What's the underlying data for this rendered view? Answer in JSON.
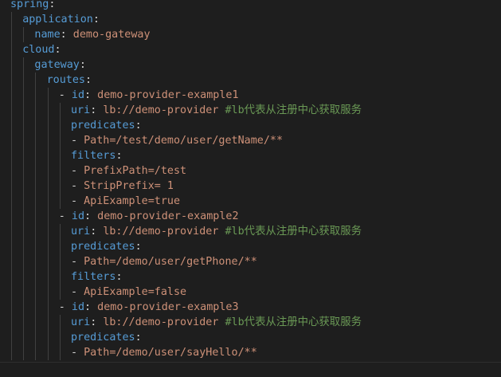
{
  "lines": [
    {
      "indent": 0,
      "dash": false,
      "key": "spring",
      "value": "",
      "comment": ""
    },
    {
      "indent": 1,
      "dash": false,
      "key": "application",
      "value": "",
      "comment": ""
    },
    {
      "indent": 2,
      "dash": false,
      "key": "name",
      "value": "demo-gateway",
      "comment": ""
    },
    {
      "indent": 1,
      "dash": false,
      "key": "cloud",
      "value": "",
      "comment": ""
    },
    {
      "indent": 2,
      "dash": false,
      "key": "gateway",
      "value": "",
      "comment": ""
    },
    {
      "indent": 3,
      "dash": false,
      "key": "routes",
      "value": "",
      "comment": ""
    },
    {
      "indent": 4,
      "dash": true,
      "key": "id",
      "value": "demo-provider-example1",
      "comment": ""
    },
    {
      "indent": 5,
      "dash": false,
      "key": "uri",
      "value": "lb://demo-provider",
      "comment": "#lb代表从注册中心获取服务"
    },
    {
      "indent": 5,
      "dash": false,
      "key": "predicates",
      "value": "",
      "comment": ""
    },
    {
      "indent": 5,
      "dash": true,
      "key": "",
      "value": "Path=/test/demo/user/getName/**",
      "comment": ""
    },
    {
      "indent": 5,
      "dash": false,
      "key": "filters",
      "value": "",
      "comment": ""
    },
    {
      "indent": 5,
      "dash": true,
      "key": "",
      "value": "PrefixPath=/test",
      "comment": ""
    },
    {
      "indent": 5,
      "dash": true,
      "key": "",
      "value": "StripPrefix= 1",
      "comment": ""
    },
    {
      "indent": 5,
      "dash": true,
      "key": "",
      "value": "ApiExample=true",
      "comment": ""
    },
    {
      "indent": 4,
      "dash": true,
      "key": "id",
      "value": "demo-provider-example2",
      "comment": ""
    },
    {
      "indent": 5,
      "dash": false,
      "key": "uri",
      "value": "lb://demo-provider",
      "comment": "#lb代表从注册中心获取服务"
    },
    {
      "indent": 5,
      "dash": false,
      "key": "predicates",
      "value": "",
      "comment": ""
    },
    {
      "indent": 5,
      "dash": true,
      "key": "",
      "value": "Path=/demo/user/getPhone/**",
      "comment": ""
    },
    {
      "indent": 5,
      "dash": false,
      "key": "filters",
      "value": "",
      "comment": ""
    },
    {
      "indent": 5,
      "dash": true,
      "key": "",
      "value": "ApiExample=false",
      "comment": ""
    },
    {
      "indent": 4,
      "dash": true,
      "key": "id",
      "value": "demo-provider-example3",
      "comment": ""
    },
    {
      "indent": 5,
      "dash": false,
      "key": "uri",
      "value": "lb://demo-provider",
      "comment": "#lb代表从注册中心获取服务"
    },
    {
      "indent": 5,
      "dash": false,
      "key": "predicates",
      "value": "",
      "comment": ""
    },
    {
      "indent": 5,
      "dash": true,
      "key": "",
      "value": "Path=/demo/user/sayHello/**",
      "comment": ""
    }
  ],
  "colors": {
    "background": "#1e1e1e",
    "key": "#569cd6",
    "value": "#ce9178",
    "comment": "#6a9955",
    "punctuation": "#d4d4d4",
    "indent_guide": "#404040"
  }
}
